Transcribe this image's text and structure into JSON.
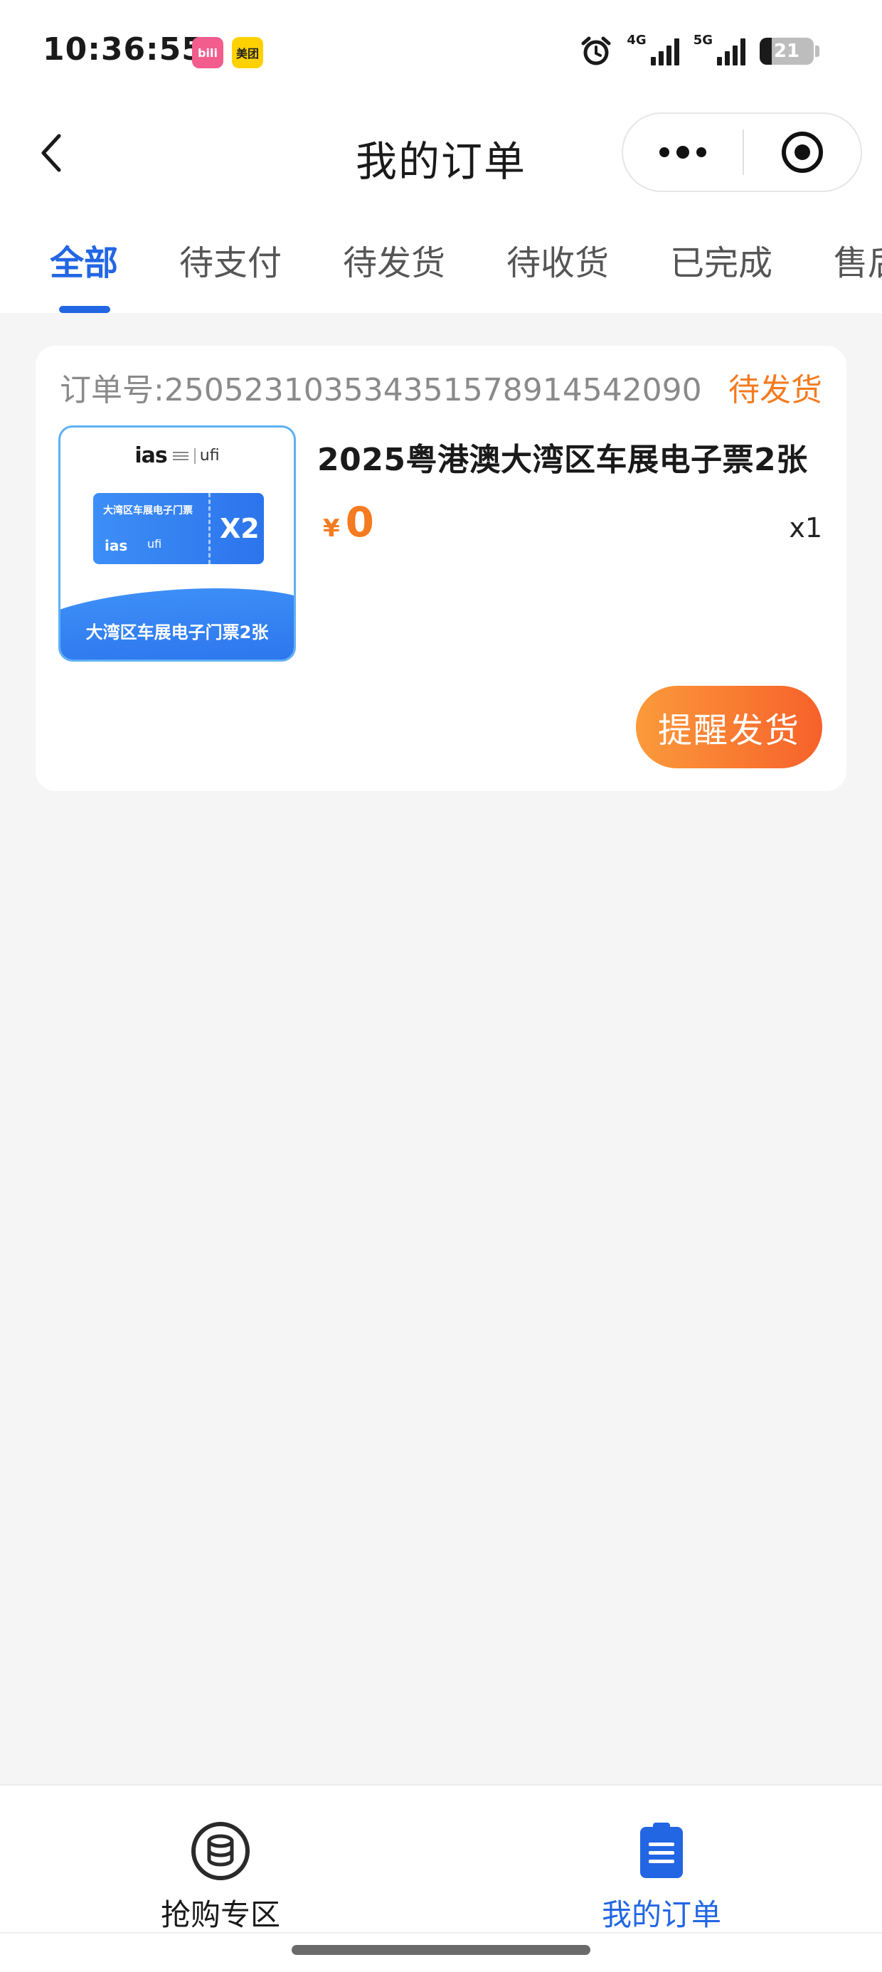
{
  "status_bar": {
    "time": "10:36:55",
    "app_icons": [
      "bilibili",
      "美团"
    ],
    "network_1": "4G",
    "network_2": "5G",
    "battery_level": "21"
  },
  "nav": {
    "title": "我的订单"
  },
  "tabs": [
    {
      "label": "全部",
      "active": true
    },
    {
      "label": "待支付",
      "active": false
    },
    {
      "label": "待发货",
      "active": false
    },
    {
      "label": "待收货",
      "active": false
    },
    {
      "label": "已完成",
      "active": false
    },
    {
      "label": "售后",
      "active": false
    }
  ],
  "orders": [
    {
      "order_number": "订单号:250523103534351578914542090",
      "status": "待发货",
      "product_name": "2025粤港澳大湾区车展电子票2张",
      "currency": "¥",
      "price": "0",
      "quantity": "x1",
      "action_label": "提醒发货",
      "thumbnail": {
        "brand": "ias",
        "partner": "ufi",
        "ticket_title": "大湾区车展电子门票",
        "ticket_count": "X2",
        "caption": "大湾区车展电子门票2张"
      }
    }
  ],
  "tabbar": {
    "items": [
      {
        "label": "抢购专区",
        "icon": "coins-icon",
        "active": false
      },
      {
        "label": "我的订单",
        "icon": "order-list-icon",
        "active": true
      }
    ]
  },
  "colors": {
    "accent_blue": "#2266e3",
    "accent_orange": "#f47b20",
    "background": "#f5f5f5"
  }
}
